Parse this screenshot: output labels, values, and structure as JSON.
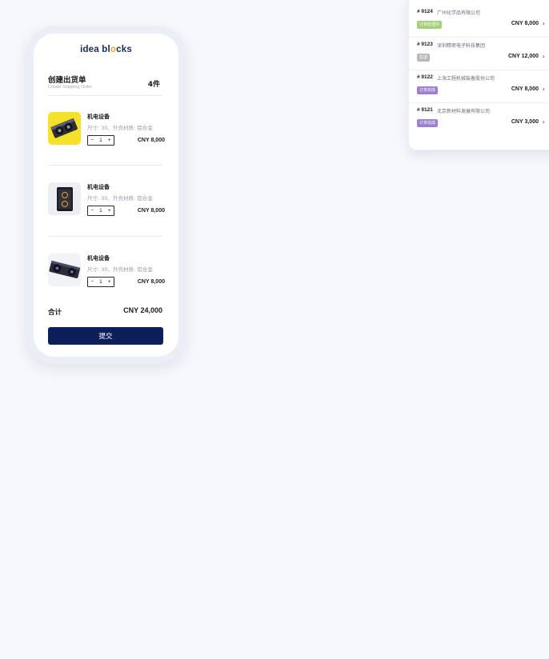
{
  "phone": {
    "logo": {
      "pre": "idea bl",
      "accent": "o",
      "post": "cks"
    },
    "header": {
      "title": "创建出货单",
      "subtitle": "Create Shipping Order",
      "count": "4件"
    },
    "items": [
      {
        "name": "机电设备",
        "spec": "尺寸: 30、外壳材质: 铝合金",
        "minus": "−",
        "qty": "1",
        "plus": "+",
        "price": "CNY 8,000",
        "thumb": "gpu-yellow"
      },
      {
        "name": "机电设备",
        "spec": "尺寸: 30、外壳材质: 铝合金",
        "minus": "−",
        "qty": "1",
        "plus": "+",
        "price": "CNY 8,000",
        "thumb": "pc-case"
      },
      {
        "name": "机电设备",
        "spec": "尺寸: 30、外壳材质: 铝合金",
        "minus": "−",
        "qty": "1",
        "plus": "+",
        "price": "CNY 8,000",
        "thumb": "gpu-dark"
      }
    ],
    "total": {
      "label": "合计",
      "value": "CNY 24,000"
    },
    "submit_label": "提交"
  },
  "orders": [
    {
      "id": "# 9124",
      "company": "广州化学品有限公司",
      "status": "订单处理中",
      "status_color": "#a6cf7c",
      "price": "CNY 8,000",
      "chevron": "›"
    },
    {
      "id": "# 9123",
      "company": "深圳精密电子科技集团",
      "status": "驳退",
      "status_color": "#b8b9bd",
      "price": "CNY 12,000",
      "chevron": "›"
    },
    {
      "id": "# 9122",
      "company": "上海工程机械装备股份公司",
      "status": "订单完成",
      "status_color": "#9b7fd0",
      "price": "CNY 8,000",
      "chevron": "›"
    },
    {
      "id": "# 9121",
      "company": "北京新材料发展有限公司",
      "status": "订单完成",
      "status_color": "#9b7fd0",
      "price": "CNY 3,000",
      "chevron": "›"
    }
  ],
  "colors": {
    "primary": "#0d1f5a",
    "accent": "#f2a33a",
    "background": "#f7f8fc"
  }
}
